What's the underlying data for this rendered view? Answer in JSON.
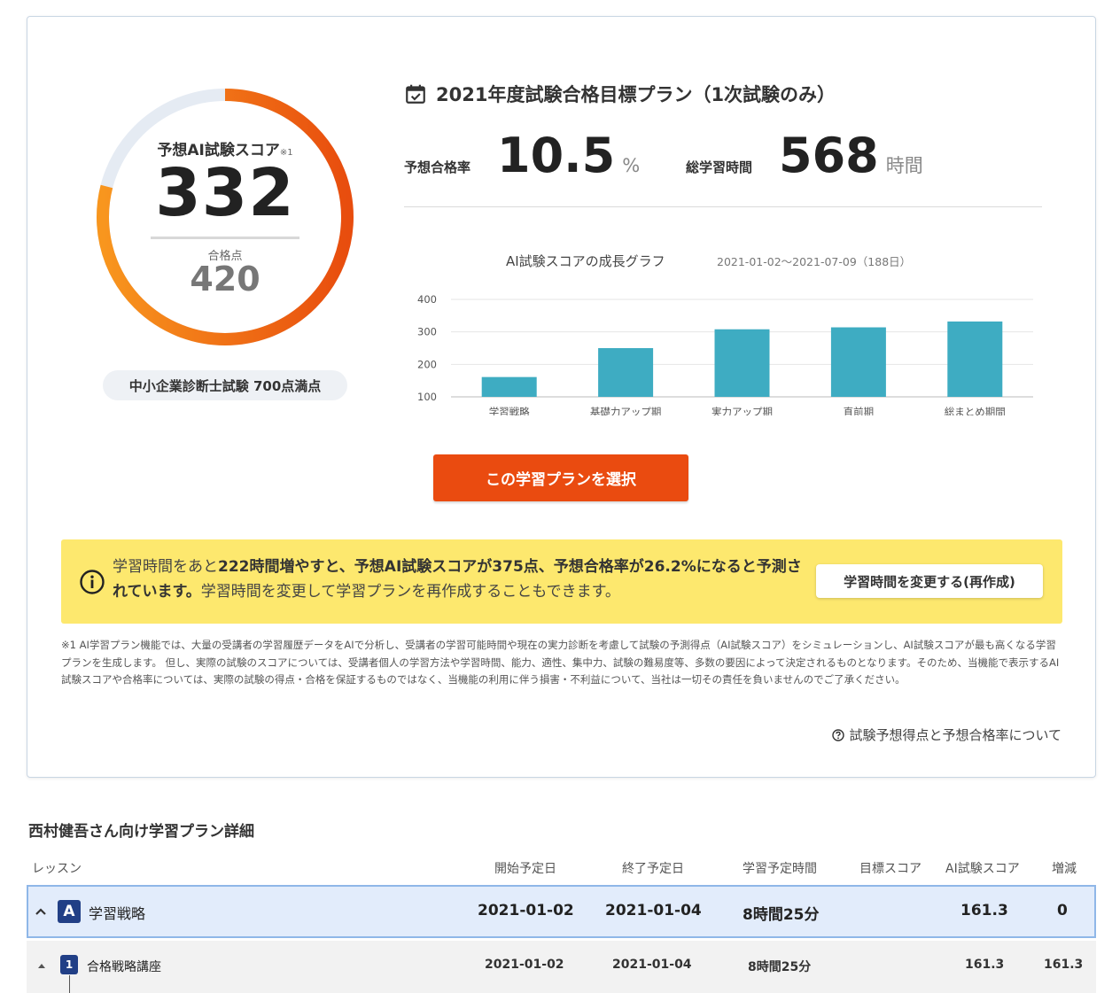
{
  "gauge": {
    "title": "予想AI試験スコア",
    "note_mark": "※1",
    "score": "332",
    "pass_label": "合格点",
    "pass_score": "420",
    "progress_fraction": 0.79,
    "track_color": "#e5ebf3",
    "arc_colors": [
      "#f8961e",
      "#e84d0e"
    ]
  },
  "exam_label": "中小企業診断士試験 700点満点",
  "plan": {
    "title": "2021年度試験合格目標プラン（1次試験のみ）",
    "pass_rate_label": "予想合格率",
    "pass_rate_value": "10.5",
    "pass_rate_unit": "%",
    "study_time_label": "総学習時間",
    "study_time_value": "568",
    "study_time_unit": "時間"
  },
  "chart_data": {
    "type": "bar",
    "title": "AI試験スコアの成長グラフ",
    "subtitle": "2021-01-02〜2021-07-09（188日）",
    "categories": [
      "学習戦略",
      "基礎力アップ期",
      "実力アップ期",
      "直前期",
      "総まとめ期間"
    ],
    "values": [
      161,
      250,
      308,
      314,
      332
    ],
    "yticks": [
      "100",
      "200",
      "300",
      "400"
    ],
    "ylim": [
      100,
      400
    ],
    "bar_color": "#3eacc2",
    "grid": true
  },
  "select_button": "この学習プランを選択",
  "notice": {
    "part1": "学習時間をあと",
    "part2": "222時間増やすと、予想AI試験スコアが375点、予想合格率が26.2%になると予測されています。",
    "part3": "学習時間を変更して学習プランを再作成することもできます。",
    "button": "学習時間を変更する(再作成)"
  },
  "disclaimer": "※1 AI学習プラン機能では、大量の受講者の学習履歴データをAIで分析し、受講者の学習可能時間や現在の実力診断を考慮して試験の予測得点（AI試験スコア）をシミュレーションし、AI試験スコアが最も高くなる学習プランを生成します。 但し、実際の試験のスコアについては、受講者個人の学習方法や学習時間、能力、適性、集中力、試験の難易度等、多数の要因によって決定されるものとなります。そのため、当機能で表示するAI試験スコアや合格率については、実際の試験の得点・合格を保証するものではなく、当機能の利用に伴う損害・不利益について、当社は一切その責任を負いませんのでご了承ください。",
  "about_link": "試験予想得点と予想合格率について",
  "detail": {
    "title": "西村健吾さん向け学習プラン詳細",
    "columns": [
      "レッスン",
      "開始予定日",
      "終了予定日",
      "学習予定時間",
      "目標スコア",
      "AI試験スコア",
      "増減"
    ],
    "section": {
      "badge": "A",
      "name": "学習戦略",
      "start": "2021-01-02",
      "end": "2021-01-04",
      "time": "8時間25分",
      "target": "",
      "ai_score": "161.3",
      "delta": "0"
    },
    "lesson": {
      "badge": "1",
      "name": "合格戦略講座",
      "start": "2021-01-02",
      "end": "2021-01-04",
      "time": "8時間25分",
      "target": "",
      "ai_score": "161.3",
      "delta": "161.3"
    }
  }
}
